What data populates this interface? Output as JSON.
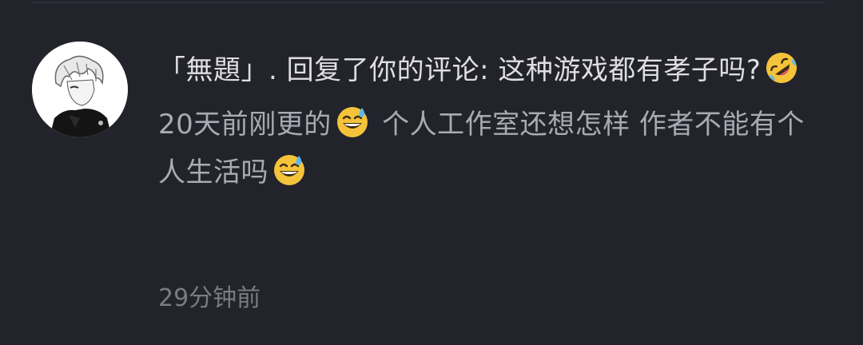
{
  "notification": {
    "reply_prefix": "「無題」",
    "reply_action": ". 回复了你的评论: 这种游戏都有孝子吗?",
    "reply_emoji": "rolling-on-floor-laughing-icon",
    "body_part1": "20天前刚更的",
    "body_emoji_1": "grinning-sweat-icon",
    "body_part2": " 个人工作室还想怎样 作者不能有个人生活吗",
    "body_emoji_2": "grinning-sweat-icon",
    "timestamp": "29分钟前"
  },
  "colors": {
    "background": "#22232b",
    "reply_text": "#dedee3",
    "body_text": "#a9aab2",
    "timestamp_text": "#7a7b83"
  }
}
